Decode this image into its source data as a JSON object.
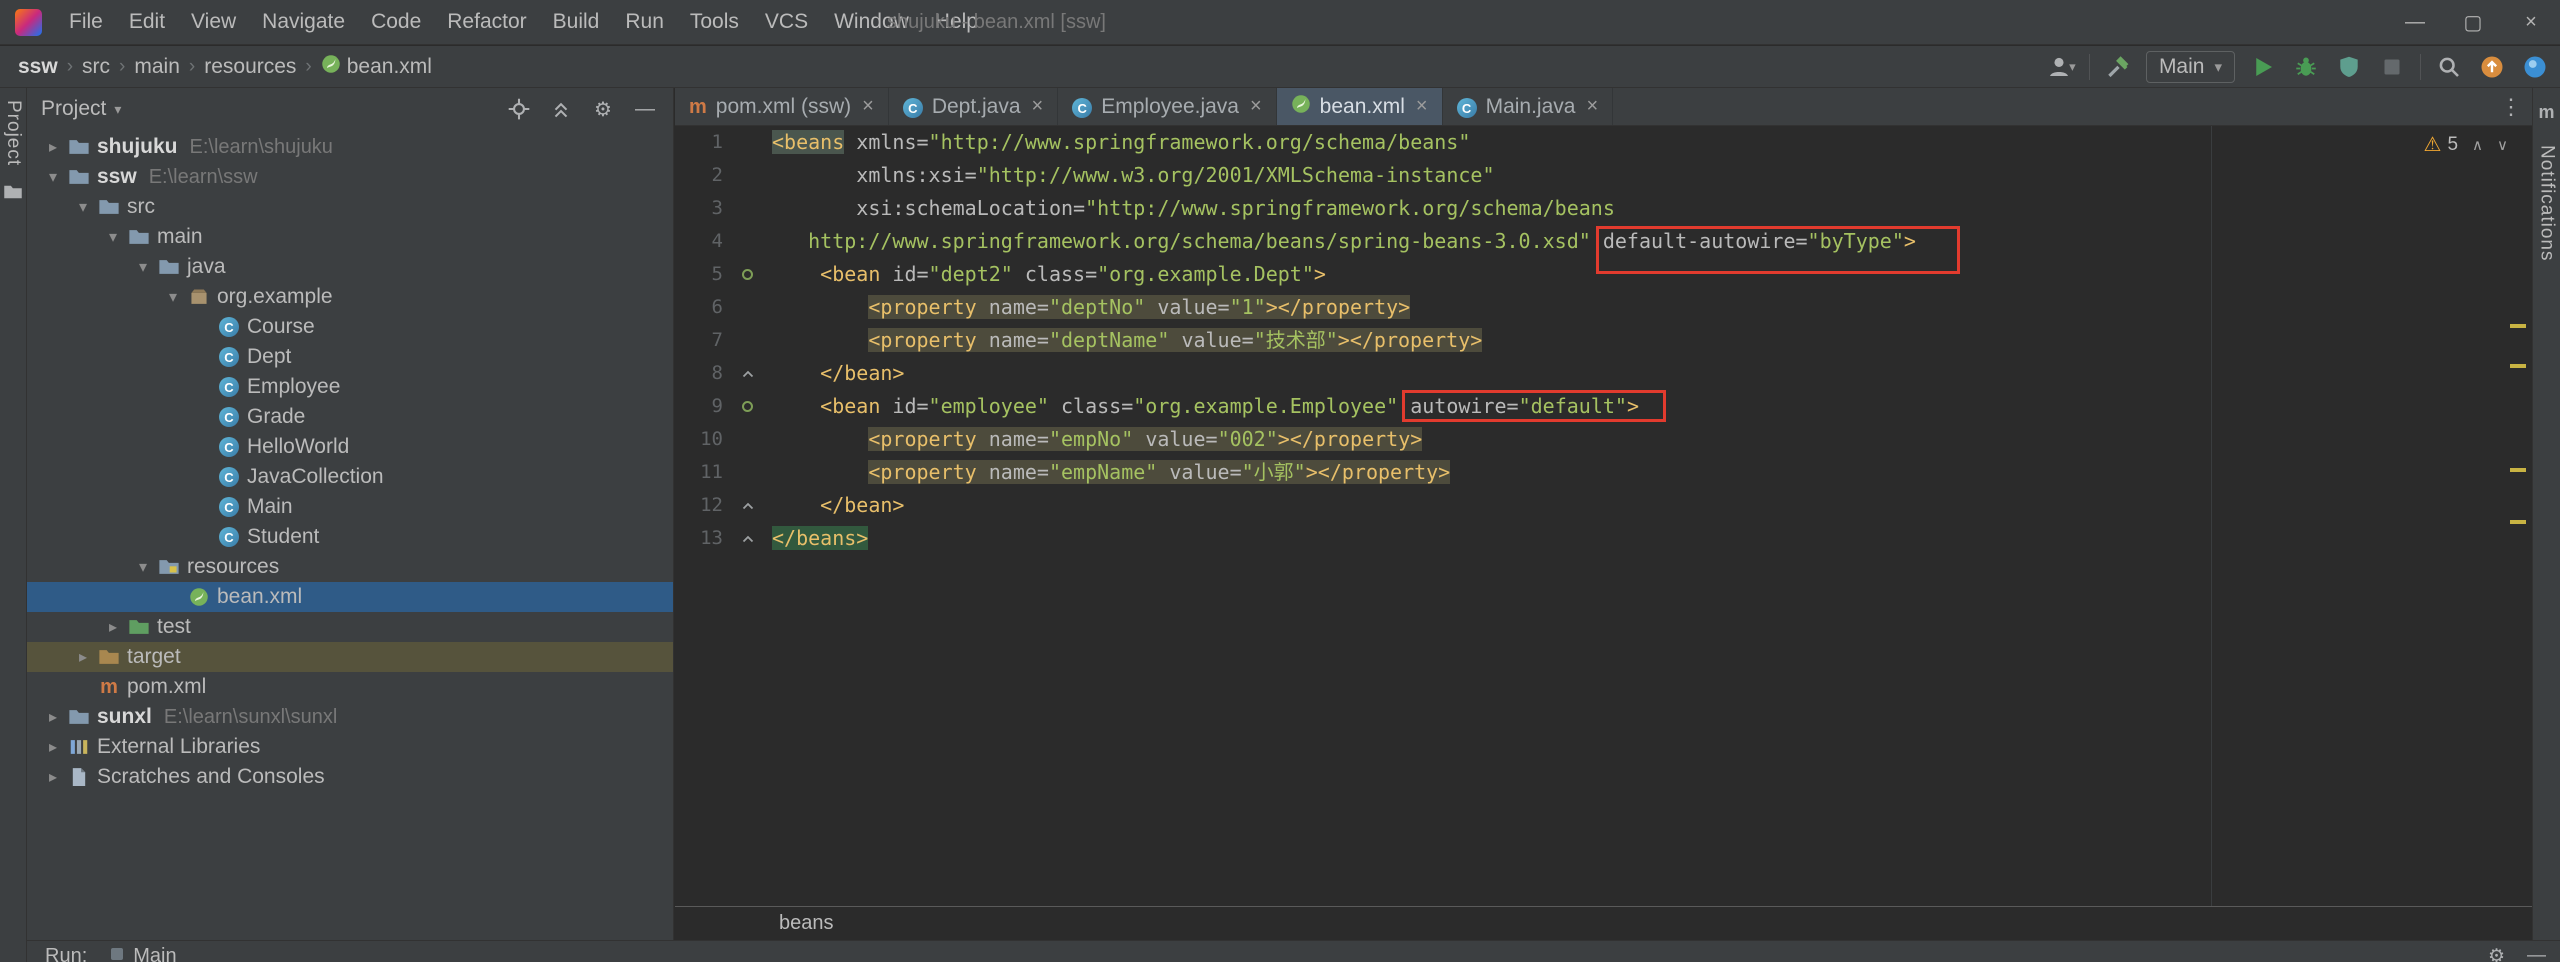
{
  "window": {
    "title": "shujuku - bean.xml [ssw]",
    "menus": [
      "File",
      "Edit",
      "View",
      "Navigate",
      "Code",
      "Refactor",
      "Build",
      "Run",
      "Tools",
      "VCS",
      "Window",
      "Help"
    ],
    "controls": [
      "minimize",
      "maximize",
      "close"
    ]
  },
  "breadcrumbs": {
    "items": [
      {
        "label": "ssw",
        "bold": true
      },
      {
        "label": "src"
      },
      {
        "label": "main"
      },
      {
        "label": "resources"
      },
      {
        "label": "bean.xml",
        "icon": "spring"
      }
    ]
  },
  "toolbar": {
    "run_config": "Main",
    "right": [
      {
        "type": "avatar",
        "name": "avatar-icon"
      },
      {
        "type": "sep"
      },
      {
        "type": "hammer",
        "name": "build-hammer-icon"
      },
      {
        "type": "combo",
        "label": "Main"
      },
      {
        "type": "play",
        "name": "run-icon"
      },
      {
        "type": "bug",
        "name": "debug-icon"
      },
      {
        "type": "shield",
        "name": "coverage-icon"
      },
      {
        "type": "stop",
        "name": "stop-icon"
      },
      {
        "type": "sep"
      },
      {
        "type": "search",
        "name": "search-everywhere-icon"
      },
      {
        "type": "update",
        "name": "update-icon"
      },
      {
        "type": "ball",
        "name": "settings-sync-icon"
      }
    ]
  },
  "left_stripe": {
    "label": "Project",
    "icon": "project-folder"
  },
  "right_stripe": {
    "label": "Notifications",
    "icon": "maven"
  },
  "project": {
    "header": "Project",
    "header_icons": [
      "locate",
      "collapse",
      "gear",
      "hide"
    ],
    "tree": [
      {
        "label": "shujuku",
        "path": "E:\\learn\\shujuku",
        "level": 0,
        "chevron": "right",
        "icon": "folder",
        "bold": true
      },
      {
        "label": "ssw",
        "path": "E:\\learn\\ssw",
        "level": 0,
        "chevron": "down",
        "icon": "folder",
        "bold": true
      },
      {
        "label": "src",
        "level": 1,
        "chevron": "down",
        "icon": "folder"
      },
      {
        "label": "main",
        "level": 2,
        "chevron": "down",
        "icon": "folder"
      },
      {
        "label": "java",
        "level": 3,
        "chevron": "down",
        "icon": "folder"
      },
      {
        "label": "org.example",
        "level": 4,
        "chevron": "down",
        "icon": "package"
      },
      {
        "label": "Course",
        "level": 5,
        "icon": "class"
      },
      {
        "label": "Dept",
        "level": 5,
        "icon": "class"
      },
      {
        "label": "Employee",
        "level": 5,
        "icon": "class"
      },
      {
        "label": "Grade",
        "level": 5,
        "icon": "class"
      },
      {
        "label": "HelloWorld",
        "level": 5,
        "icon": "class"
      },
      {
        "label": "JavaCollection",
        "level": 5,
        "icon": "class"
      },
      {
        "label": "Main",
        "level": 5,
        "icon": "class"
      },
      {
        "label": "Student",
        "level": 5,
        "icon": "class"
      },
      {
        "label": "resources",
        "level": 3,
        "chevron": "down",
        "icon": "folder-res"
      },
      {
        "label": "bean.xml",
        "level": 4,
        "icon": "spring",
        "selected": true
      },
      {
        "label": "test",
        "level": 2,
        "chevron": "right",
        "icon": "folder-test"
      },
      {
        "label": "target",
        "level": 1,
        "chevron": "right",
        "icon": "folder-excluded",
        "rowbg": "excluded"
      },
      {
        "label": "pom.xml",
        "level": 1,
        "icon": "maven"
      },
      {
        "label": "sunxl",
        "path": "E:\\learn\\sunxl\\sunxl",
        "level": 0,
        "chevron": "right",
        "icon": "folder",
        "bold": true
      },
      {
        "label": "External Libraries",
        "level": 0,
        "chevron": "right",
        "icon": "libs"
      },
      {
        "label": "Scratches and Consoles",
        "level": 0,
        "chevron": "right",
        "icon": "scratch"
      }
    ]
  },
  "tabs": [
    {
      "label": "pom.xml (ssw)",
      "icon": "maven"
    },
    {
      "label": "Dept.java",
      "icon": "class"
    },
    {
      "label": "Employee.java",
      "icon": "class"
    },
    {
      "label": "bean.xml",
      "icon": "spring",
      "active": true
    },
    {
      "label": "Main.java",
      "icon": "class"
    }
  ],
  "editor": {
    "warning_count": "5",
    "bottom_breadcrumb": "beans",
    "stripe_marks": [
      198,
      238,
      342,
      394
    ],
    "lines": [
      {
        "n": 1,
        "segs": [
          {
            "t": "<beans",
            "c": "tag",
            "bg": "caret"
          },
          {
            "t": " ",
            "c": "ws"
          },
          {
            "t": "xmlns=",
            "c": "attr"
          },
          {
            "t": "\"http://www.springframework.org/schema/beans\"",
            "c": "val"
          }
        ]
      },
      {
        "n": 2,
        "segs": [
          {
            "t": "       ",
            "c": "ws"
          },
          {
            "t": "xmlns:xsi=",
            "c": "attr"
          },
          {
            "t": "\"http://www.w3.org/2001/XMLSchema-instance\"",
            "c": "val"
          }
        ]
      },
      {
        "n": 3,
        "segs": [
          {
            "t": "       ",
            "c": "ws"
          },
          {
            "t": "xsi:schemaLocation=",
            "c": "attr"
          },
          {
            "t": "\"http://www.springframework.org/schema/beans",
            "c": "val"
          }
        ]
      },
      {
        "n": 4,
        "segs": [
          {
            "t": "   ",
            "c": "ws"
          },
          {
            "t": "http://www.springframework.org/schema/beans/spring-beans-3.0.xsd\" ",
            "c": "val"
          },
          {
            "t": "default-autowire=",
            "c": "attr",
            "box": "box1"
          },
          {
            "t": "\"byType\"",
            "c": "val",
            "box": "box1"
          },
          {
            "t": ">",
            "c": "tag",
            "box": "box1"
          }
        ]
      },
      {
        "n": 5,
        "g": "bean",
        "segs": [
          {
            "t": "    ",
            "c": "ws"
          },
          {
            "t": "<bean ",
            "c": "tag"
          },
          {
            "t": "id=",
            "c": "attr"
          },
          {
            "t": "\"dept2\"",
            "c": "val"
          },
          {
            "t": " ",
            "c": "ws"
          },
          {
            "t": "class=",
            "c": "attr"
          },
          {
            "t": "\"org.example.Dept\"",
            "c": "val"
          },
          {
            "t": ">",
            "c": "tag"
          }
        ]
      },
      {
        "n": 6,
        "segs": [
          {
            "t": "        ",
            "c": "ws"
          },
          {
            "t": "<property ",
            "c": "tag",
            "bg": "dup"
          },
          {
            "t": "name=",
            "c": "attr",
            "bg": "dup"
          },
          {
            "t": "\"deptNo\"",
            "c": "val",
            "bg": "dup"
          },
          {
            "t": " ",
            "c": "ws",
            "bg": "dup"
          },
          {
            "t": "value=",
            "c": "attr",
            "bg": "dup"
          },
          {
            "t": "\"1\"",
            "c": "val",
            "bg": "dup"
          },
          {
            "t": "></property>",
            "c": "tag",
            "bg": "dup"
          }
        ]
      },
      {
        "n": 7,
        "segs": [
          {
            "t": "        ",
            "c": "ws"
          },
          {
            "t": "<property ",
            "c": "tag",
            "bg": "dup"
          },
          {
            "t": "name=",
            "c": "attr",
            "bg": "dup"
          },
          {
            "t": "\"deptName\"",
            "c": "val",
            "bg": "dup"
          },
          {
            "t": " ",
            "c": "ws",
            "bg": "dup"
          },
          {
            "t": "value=",
            "c": "attr",
            "bg": "dup"
          },
          {
            "t": "\"技术部\"",
            "c": "val",
            "bg": "dup"
          },
          {
            "t": "></property>",
            "c": "tag",
            "bg": "dup"
          }
        ]
      },
      {
        "n": 8,
        "g": "fold",
        "segs": [
          {
            "t": "    ",
            "c": "ws"
          },
          {
            "t": "</bean>",
            "c": "tag"
          }
        ]
      },
      {
        "n": 9,
        "g": "bean",
        "segs": [
          {
            "t": "    ",
            "c": "ws"
          },
          {
            "t": "<bean ",
            "c": "tag"
          },
          {
            "t": "id=",
            "c": "attr"
          },
          {
            "t": "\"employee\"",
            "c": "val"
          },
          {
            "t": " ",
            "c": "ws"
          },
          {
            "t": "class=",
            "c": "attr"
          },
          {
            "t": "\"org.example.Employee\"",
            "c": "val"
          },
          {
            "t": " ",
            "c": "ws"
          },
          {
            "t": "autowire=",
            "c": "attr",
            "box": "box2"
          },
          {
            "t": "\"default\"",
            "c": "val",
            "box": "box2"
          },
          {
            "t": ">",
            "c": "tag",
            "box": "box2"
          }
        ]
      },
      {
        "n": 10,
        "segs": [
          {
            "t": "        ",
            "c": "ws"
          },
          {
            "t": "<property ",
            "c": "tag",
            "bg": "dup"
          },
          {
            "t": "name=",
            "c": "attr",
            "bg": "dup"
          },
          {
            "t": "\"empNo\"",
            "c": "val",
            "bg": "dup"
          },
          {
            "t": " ",
            "c": "ws",
            "bg": "dup"
          },
          {
            "t": "value=",
            "c": "attr",
            "bg": "dup"
          },
          {
            "t": "\"002\"",
            "c": "val",
            "bg": "dup"
          },
          {
            "t": "></property>",
            "c": "tag",
            "bg": "dup"
          }
        ]
      },
      {
        "n": 11,
        "segs": [
          {
            "t": "        ",
            "c": "ws"
          },
          {
            "t": "<property ",
            "c": "tag",
            "bg": "dup"
          },
          {
            "t": "name=",
            "c": "attr",
            "bg": "dup"
          },
          {
            "t": "\"empName\"",
            "c": "val",
            "bg": "dup"
          },
          {
            "t": " ",
            "c": "ws",
            "bg": "dup"
          },
          {
            "t": "value=",
            "c": "attr",
            "bg": "dup"
          },
          {
            "t": "\"小郭\"",
            "c": "val",
            "bg": "dup"
          },
          {
            "t": "></property>",
            "c": "tag",
            "bg": "dup"
          }
        ]
      },
      {
        "n": 12,
        "g": "fold",
        "segs": [
          {
            "t": "    ",
            "c": "ws"
          },
          {
            "t": "</bean>",
            "c": "tag"
          }
        ]
      },
      {
        "n": 13,
        "g": "fold",
        "segs": [
          {
            "t": "</beans>",
            "c": "tag",
            "bg": "match"
          }
        ]
      }
    ]
  },
  "run_bar": {
    "label": "Run:",
    "tab": "Main"
  }
}
